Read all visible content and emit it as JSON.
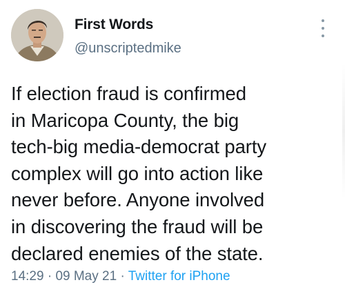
{
  "author": {
    "display_name": "First Words",
    "handle": "@unscriptedmike",
    "avatar_icon": "profile-photo"
  },
  "tweet": {
    "text": "If election fraud is confirmed\nin Maricopa County, the big\ntech-big media-democrat party\ncomplex will go into action like\nnever before. Anyone involved\nin discovering the fraud will be\ndeclared enemies of the state."
  },
  "meta": {
    "time": "14:29",
    "separator": "·",
    "date": "09 May 21",
    "source": "Twitter for iPhone"
  },
  "colors": {
    "text": "#14171a",
    "secondary": "#5b7083",
    "link": "#1da1f2"
  }
}
